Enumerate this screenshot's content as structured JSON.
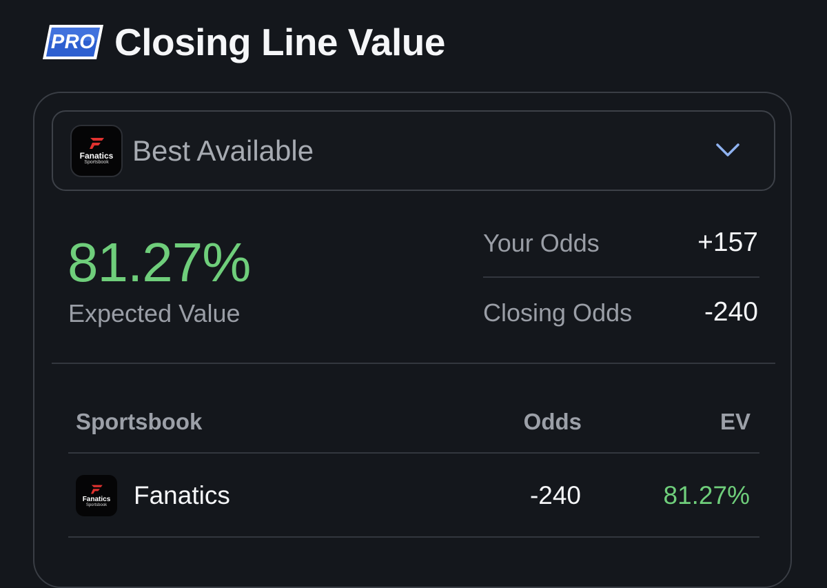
{
  "header": {
    "badge_label": "PRO",
    "title": "Closing Line Value"
  },
  "selector": {
    "book_logo_word": "Fanatics",
    "book_logo_sub": "Sportsbook",
    "label": "Best Available",
    "icon": "chevron-down-icon"
  },
  "summary": {
    "ev_value": "81.27%",
    "ev_label": "Expected Value",
    "your_odds_label": "Your Odds",
    "your_odds_value": "+157",
    "closing_odds_label": "Closing Odds",
    "closing_odds_value": "-240"
  },
  "table": {
    "headers": [
      "Sportsbook",
      "Odds",
      "EV"
    ],
    "rows": [
      {
        "logo_word": "Fanatics",
        "logo_sub": "Sportsbook",
        "book": "Fanatics",
        "odds": "-240",
        "ev": "81.27%"
      }
    ]
  },
  "colors": {
    "background": "#14171c",
    "positive": "#6fce7b",
    "brand_red": "#e0322f",
    "badge_blue": "#2d5fd0",
    "chevron": "#8fb2f0"
  }
}
